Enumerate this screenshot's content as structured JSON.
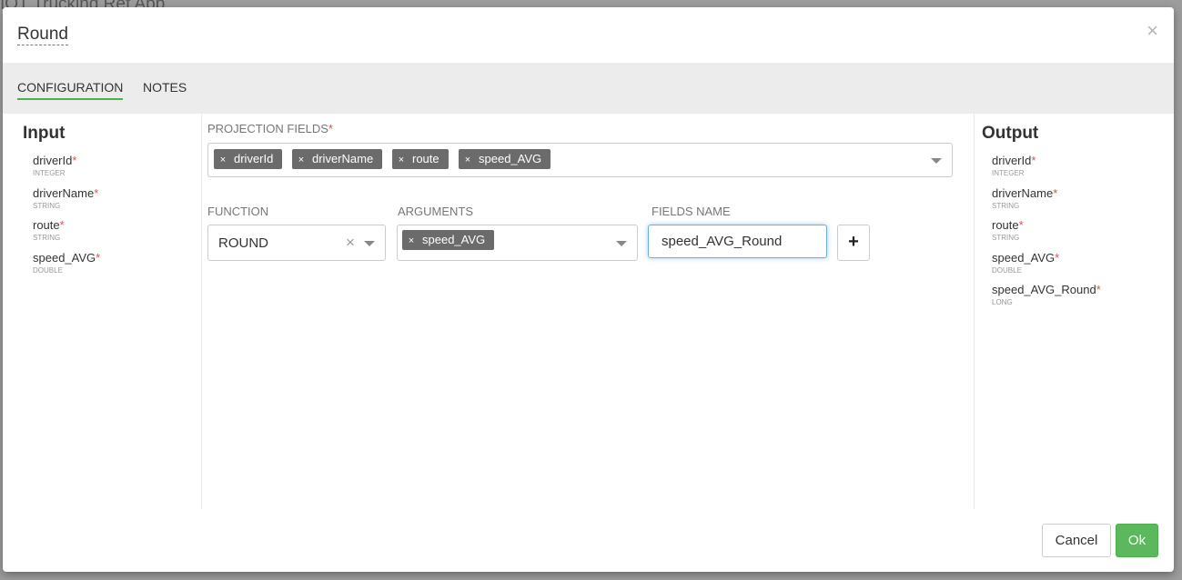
{
  "background": {
    "app_title": "IOT Trucking Ref App"
  },
  "modal": {
    "title": "Round",
    "close_glyph": "×",
    "tabs": [
      {
        "label": "CONFIGURATION",
        "active": true
      },
      {
        "label": "NOTES",
        "active": false
      }
    ]
  },
  "input": {
    "title": "Input",
    "fields": [
      {
        "name": "driverId",
        "type": "INTEGER",
        "required": "*"
      },
      {
        "name": "driverName",
        "type": "STRING",
        "required": "*"
      },
      {
        "name": "route",
        "type": "STRING",
        "required": "*"
      },
      {
        "name": "speed_AVG",
        "type": "DOUBLE",
        "required": "*"
      }
    ]
  },
  "center": {
    "projection_label": "PROJECTION FIELDS",
    "required_marker": "*",
    "projection_fields": [
      "driverId",
      "driverName",
      "route",
      "speed_AVG"
    ],
    "chip_remove_glyph": "×",
    "function_label": "FUNCTION",
    "function_value": "ROUND",
    "function_clear_glyph": "×",
    "arguments_label": "ARGUMENTS",
    "arguments": [
      "speed_AVG"
    ],
    "fields_name_label": "FIELDS NAME",
    "fields_name_value": "speed_AVG_Round",
    "add_glyph": "+"
  },
  "output": {
    "title": "Output",
    "fields": [
      {
        "name": "driverId",
        "type": "INTEGER",
        "required": "*"
      },
      {
        "name": "driverName",
        "type": "STRING",
        "required": "*"
      },
      {
        "name": "route",
        "type": "STRING",
        "required": "*"
      },
      {
        "name": "speed_AVG",
        "type": "DOUBLE",
        "required": "*"
      },
      {
        "name": "speed_AVG_Round",
        "type": "LONG",
        "required": "*"
      }
    ]
  },
  "footer": {
    "cancel_label": "Cancel",
    "ok_label": "Ok"
  },
  "colors": {
    "accent_green": "#4caf50",
    "ok_button": "#5cb85c",
    "chip_bg": "#6b6b6b",
    "required": "#d9534f",
    "focus_blue": "#66afe9"
  }
}
